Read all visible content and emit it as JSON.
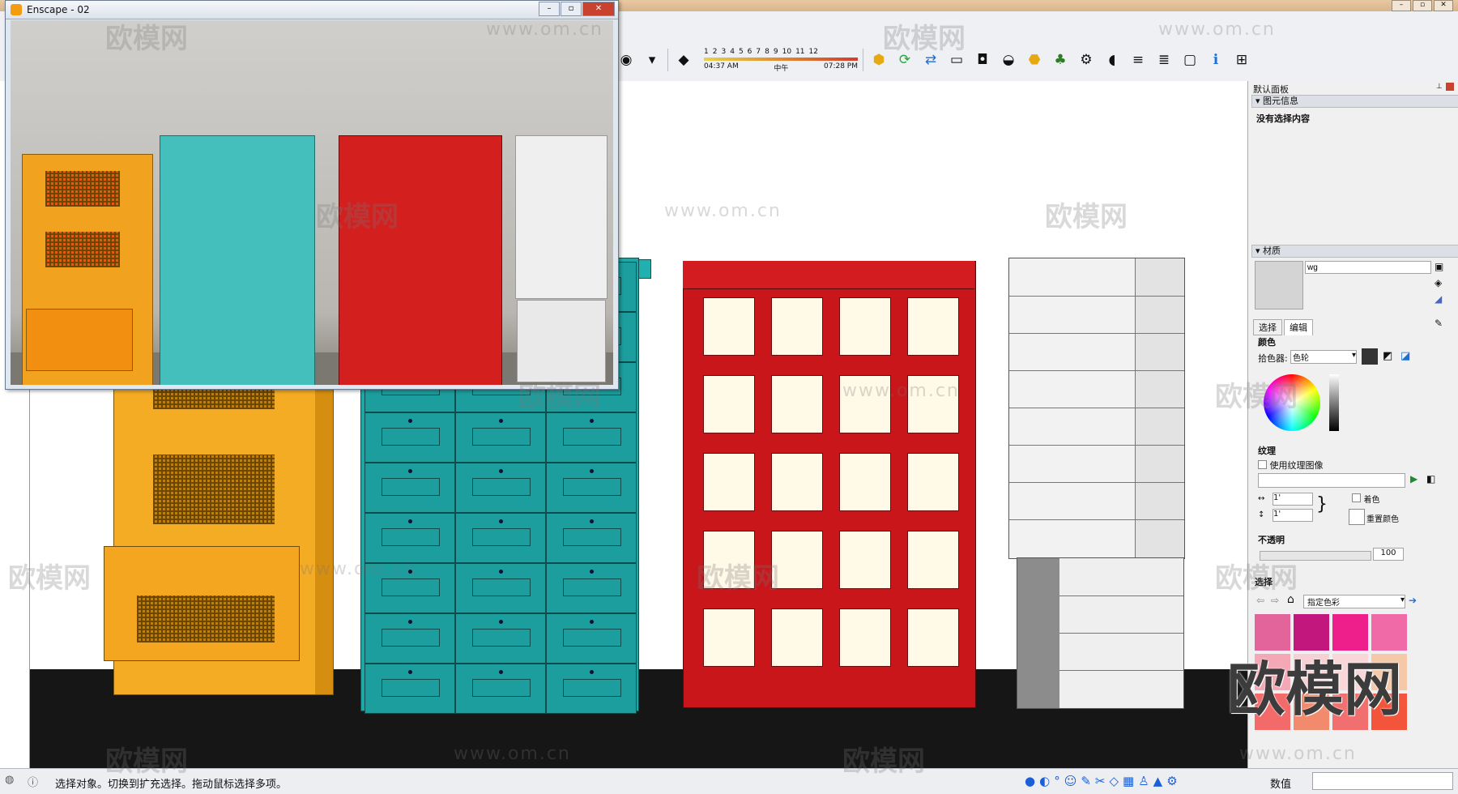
{
  "enscape": {
    "title": "Enscape - 02"
  },
  "toolbar": {
    "months": [
      "1",
      "2",
      "3",
      "4",
      "5",
      "6",
      "7",
      "8",
      "9",
      "10",
      "11",
      "12"
    ],
    "time_start": "04:37 AM",
    "time_mid": "中午",
    "time_end": "07:28 PM"
  },
  "panel": {
    "title": "默认面板",
    "entity_info": {
      "header": "图元信息",
      "empty": "没有选择内容"
    },
    "materials": {
      "header": "材质",
      "name_value": "wg",
      "tabs": [
        "选择",
        "编辑"
      ],
      "color_label": "颜色",
      "picker_label": "拾色器:",
      "picker_value": "色轮",
      "texture_label": "纹理",
      "use_texture": "使用纹理图像",
      "size_w": "1'",
      "size_h": "1'",
      "colorize": "着色",
      "reset_color": "重置颜色",
      "opacity_label": "不透明",
      "opacity_value": "100"
    },
    "select": {
      "header": "选择",
      "dropdown": "指定色彩"
    },
    "swatch_colors": [
      "#e2649a",
      "#c2177c",
      "#ee1e8a",
      "#f06aa8",
      "#f4a7b4",
      "#f7d0d4",
      "#f9d7d9",
      "#f5c8a8",
      "#f26a6a",
      "#f28a6e",
      "#f26f6f",
      "#f2553b"
    ]
  },
  "status": {
    "text": "选择对象。切换到扩充选择。拖动鼠标选择多项。",
    "measure_label": "数值"
  },
  "watermark": {
    "brand": "欧模网",
    "url": "www.om.cn"
  }
}
